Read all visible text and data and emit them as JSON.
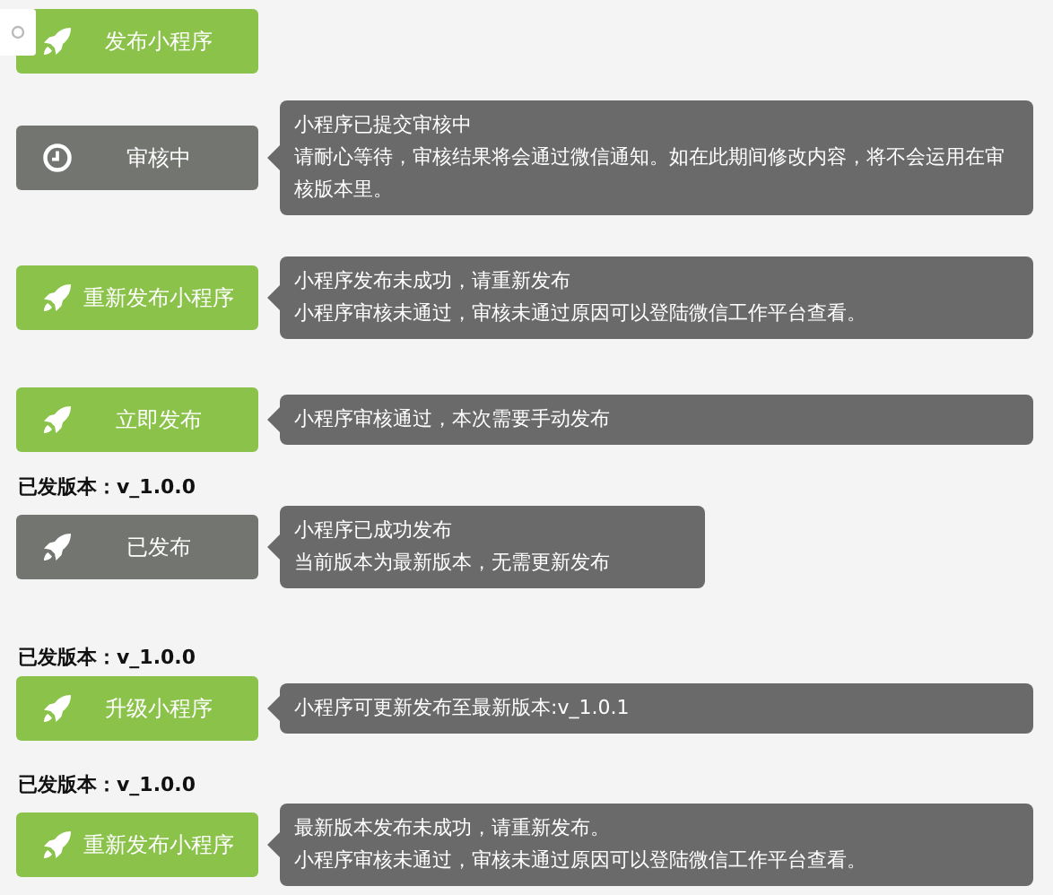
{
  "rows": [
    {
      "version_label": null,
      "button": {
        "label": "发布小程序",
        "kind": "action"
      },
      "tooltip": null,
      "toggle": true
    },
    {
      "version_label": null,
      "button": {
        "label": "审核中",
        "kind": "pending"
      },
      "tooltip": [
        "小程序已提交审核中",
        "请耐心等待，审核结果将会通过微信通知。如在此期间修改内容，将不会运用在审核版本里。"
      ]
    },
    {
      "version_label": null,
      "button": {
        "label": "重新发布小程序",
        "kind": "action"
      },
      "tooltip": [
        "小程序发布未成功，请重新发布",
        "小程序审核未通过，审核未通过原因可以登陆微信工作平台查看。"
      ]
    },
    {
      "version_label": null,
      "button": {
        "label": "立即发布",
        "kind": "action"
      },
      "tooltip": [
        "小程序审核通过，本次需要手动发布"
      ]
    },
    {
      "version_label": "已发版本：v_1.0.0",
      "button": {
        "label": "已发布",
        "kind": "done"
      },
      "tooltip": [
        "小程序已成功发布",
        "当前版本为最新版本，无需更新发布"
      ]
    },
    {
      "version_label": "已发版本：v_1.0.0",
      "button": {
        "label": "升级小程序",
        "kind": "action"
      },
      "tooltip": [
        "小程序可更新发布至最新版本:v_1.0.1"
      ]
    },
    {
      "version_label": "已发版本：v_1.0.0",
      "button": {
        "label": "重新发布小程序",
        "kind": "action"
      },
      "tooltip": [
        "最新版本发布未成功，请重新发布。",
        "小程序审核未通过，审核未通过原因可以登陆微信工作平台查看。"
      ]
    }
  ]
}
